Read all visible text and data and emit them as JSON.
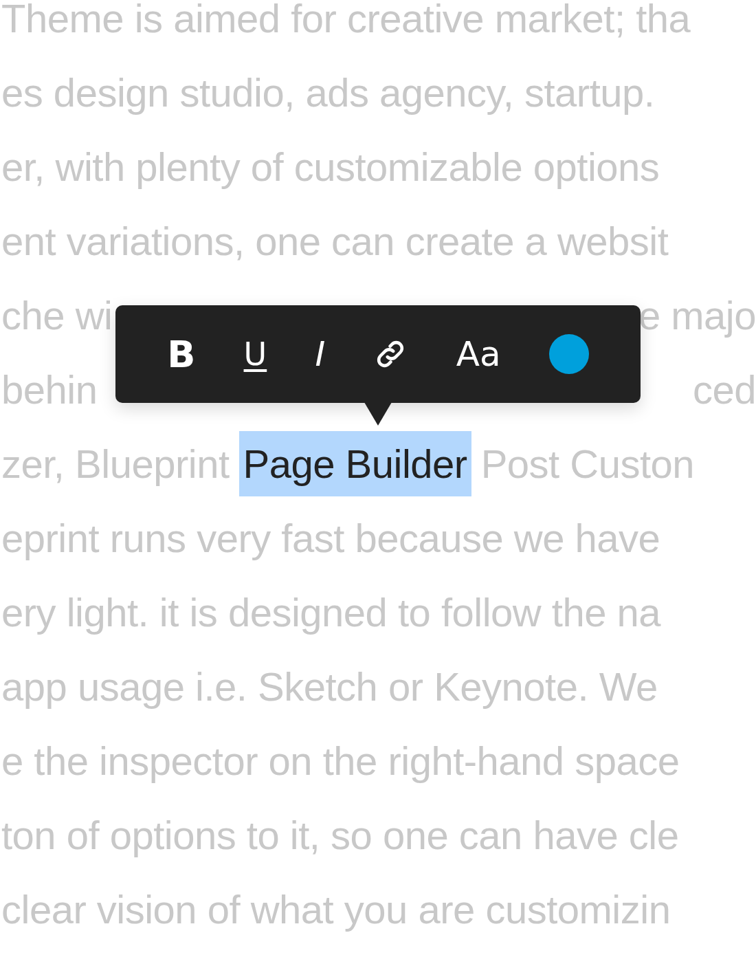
{
  "lines": [
    {
      "segments": [
        {
          "text": "Theme is aimed for creative market; tha",
          "selected": false
        }
      ]
    },
    {
      "segments": [
        {
          "text": "es design studio, ads agency, startup.",
          "selected": false
        }
      ]
    },
    {
      "segments": [
        {
          "text": "er, with plenty of customizable options",
          "selected": false
        }
      ]
    },
    {
      "segments": [
        {
          "text": "ent variations, one can create a websit",
          "selected": false
        }
      ]
    },
    {
      "segments": [
        {
          "text": "che wi",
          "selected": false
        },
        {
          "text": "e majo",
          "selected": false
        }
      ]
    },
    {
      "segments": [
        {
          "text": "behin",
          "selected": false
        },
        {
          "text": "ced",
          "selected": false
        }
      ]
    },
    {
      "segments": [
        {
          "text": "zer, Blueprint",
          "selected": false
        },
        {
          "text": "Page Builder",
          "selected": true
        },
        {
          "text": "Post Custon",
          "selected": false
        }
      ]
    },
    {
      "segments": [
        {
          "text": "eprint runs very fast because we have",
          "selected": false
        }
      ]
    },
    {
      "segments": [
        {
          "text": "ery light. it is designed to follow the na",
          "selected": false
        }
      ]
    },
    {
      "segments": [
        {
          "text": "app usage i.e. Sketch or Keynote. We",
          "selected": false
        }
      ]
    },
    {
      "segments": [
        {
          "text": "e the inspector on the right-hand space",
          "selected": false
        }
      ]
    },
    {
      "segments": [
        {
          "text": "ton of options to it, so one can have cle",
          "selected": false
        }
      ]
    },
    {
      "segments": [
        {
          "text": "clear vision of what you are customizin",
          "selected": false
        }
      ]
    }
  ],
  "toolbar": {
    "buttons": [
      {
        "kind": "bold",
        "label": "B"
      },
      {
        "kind": "underline",
        "label": "U"
      },
      {
        "kind": "italic",
        "label": "I"
      },
      {
        "kind": "link"
      },
      {
        "kind": "size",
        "label": "Aa"
      },
      {
        "kind": "color",
        "color": "#00a0dc"
      }
    ]
  }
}
